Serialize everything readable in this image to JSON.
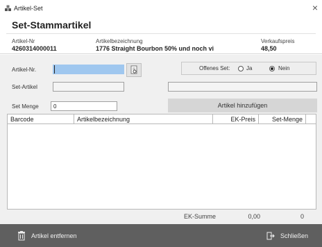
{
  "window": {
    "title": "Artikel-Set",
    "close_symbol": "×"
  },
  "header": {
    "title": "Set-Stammartikel"
  },
  "info": {
    "artikel_nr_label": "Artikel-Nr",
    "artikel_nr_value": "4260314000011",
    "bezeichnung_label": "Artikelbezeichnung",
    "bezeichnung_value": "1776 Straight Bourbon 50% und noch vi",
    "preis_label": "Verkaufspreis",
    "preis_value": "48,50"
  },
  "form": {
    "artikel_nr_label": "Artikel-Nr.",
    "artikel_nr_value": "",
    "set_artikel_label": "Set-Artikel",
    "set_artikel_value": "",
    "set_artikel_desc": "",
    "set_menge_label": "Set Menge",
    "set_menge_value": "0",
    "offenes_set_label": "Offenes Set:",
    "radio_ja_label": "Ja",
    "radio_nein_label": "Nein",
    "offenes_set_selected": "Nein",
    "add_button_label": "Artikel hinzufügen"
  },
  "table": {
    "columns": [
      "Barcode",
      "Artikelbezeichnung",
      "EK-Preis",
      "Set-Menge"
    ],
    "rows": []
  },
  "summary": {
    "label": "EK-Summe",
    "ek_value": "0,00",
    "menge_value": "0"
  },
  "footer": {
    "remove_label": "Artikel entfernen",
    "close_label": "Schließen"
  },
  "icons": {
    "window": "box-stack-icon",
    "picker": "document-search-icon",
    "remove": "trash-icon",
    "close": "exit-icon"
  }
}
